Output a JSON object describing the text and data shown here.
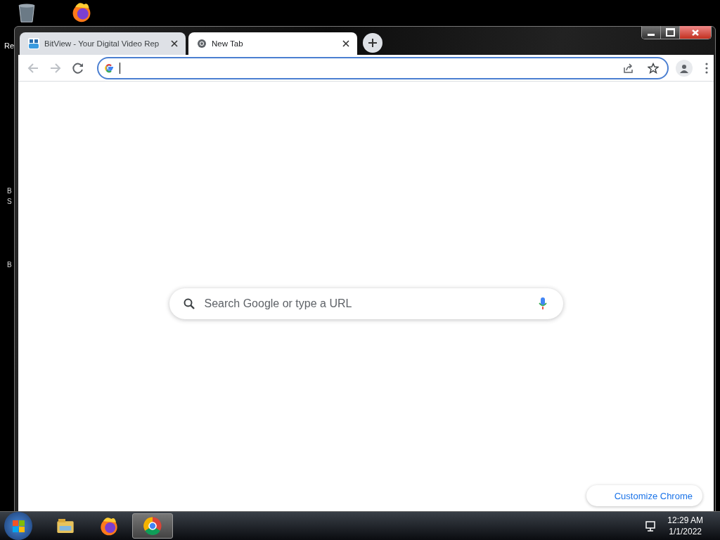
{
  "desktop": {
    "icons": [
      {
        "kind": "trash",
        "label": "Re"
      },
      {
        "kind": "firefox"
      }
    ],
    "edge_labels": [
      "B",
      "S",
      "B"
    ]
  },
  "browser": {
    "tabs": [
      {
        "title": "BitView - Your Digital Video Rep",
        "kind": "bitview",
        "selected": false
      },
      {
        "title": "New Tab",
        "kind": "chrome",
        "selected": true
      }
    ],
    "address_bar": {
      "focused": true
    },
    "nav": {
      "back_disabled": true,
      "forward_disabled": true
    },
    "search": {
      "placeholder": "Search Google or type a URL"
    },
    "customize_button": "Customize Chrome"
  },
  "taskbar": {
    "apps": [
      {
        "kind": "explorer",
        "selected": false
      },
      {
        "kind": "firefox",
        "selected": false
      },
      {
        "kind": "chrome",
        "selected": true
      }
    ],
    "time": "12:29 AM",
    "date": "1/1/2022"
  }
}
